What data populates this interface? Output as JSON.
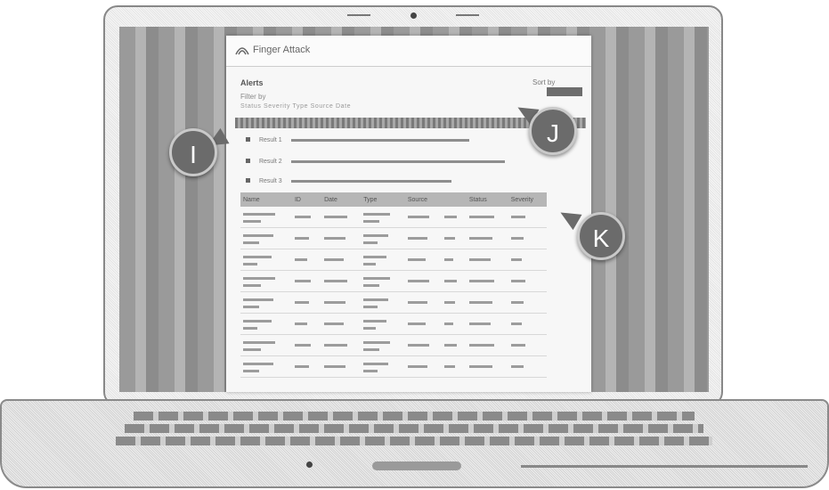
{
  "app": {
    "name": "Finger Attack"
  },
  "page": {
    "heading": "Alerts",
    "top_right": "Sort by",
    "subline": "Filter by",
    "filter_line": "Status  Severity  Type  Source  Date"
  },
  "results": [
    {
      "label": "Result 1"
    },
    {
      "label": "Result 2"
    },
    {
      "label": "Result 3"
    }
  ],
  "table": {
    "columns": [
      "Name",
      "ID",
      "Date",
      "Type",
      "Source",
      "",
      "Status",
      "Severity"
    ],
    "rows": 8
  },
  "callouts": {
    "i": "I",
    "j": "J",
    "k": "K"
  },
  "colors": {
    "callout_fill": "#6b6b6b",
    "callout_ring": "#c9c9c9",
    "screen_bg": "#f7f7f7"
  }
}
